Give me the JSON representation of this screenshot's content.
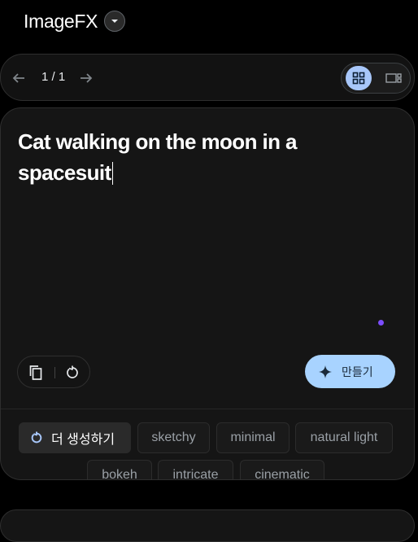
{
  "app": {
    "title": "ImageFX"
  },
  "pager": {
    "indicator": "1 / 1"
  },
  "prompt": {
    "text": "Cat walking on the moon in a spacesuit"
  },
  "actions": {
    "create_label": "만들기"
  },
  "suggestions": {
    "more_label": "더 생성하기",
    "chips": [
      "sketchy",
      "minimal",
      "natural light",
      "bokeh",
      "intricate",
      "cinematic"
    ]
  },
  "icons": {
    "title_dropdown": "chevron-down-icon",
    "prev": "arrow-left-icon",
    "next": "arrow-right-icon",
    "grid_view": "grid-icon",
    "single_view": "image-view-icon",
    "copy": "copy-icon",
    "reset": "refresh-icon",
    "create": "sparkle-icon",
    "more": "refresh-icon"
  },
  "colors": {
    "background": "#000000",
    "card": "#151515",
    "accent": "#a8d3ff",
    "toggle_active": "#a8c7fa",
    "status_dot": "#7c4dff"
  }
}
